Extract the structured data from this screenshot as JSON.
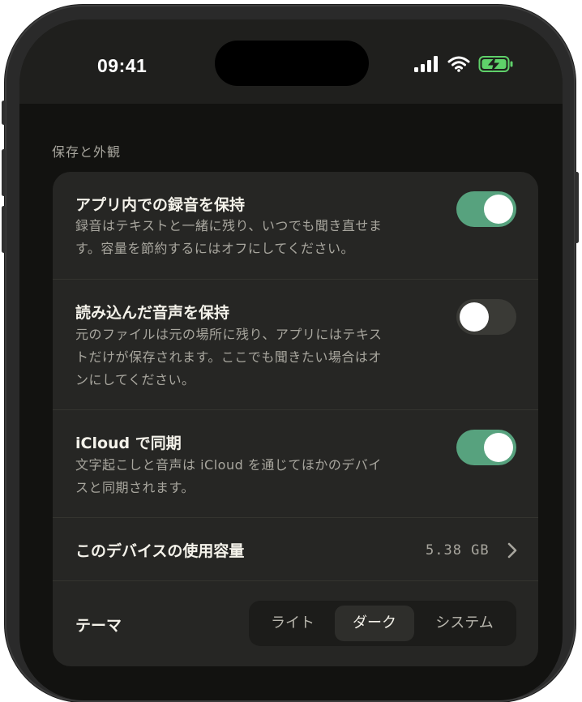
{
  "status_bar": {
    "time": "09:41"
  },
  "section_title": "保存と外観",
  "settings": {
    "keep_recordings": {
      "title": "アプリ内での録音を保持",
      "desc_line1": "録音はテキストと一緒に残り、いつでも聞き直せま",
      "desc_line2": "す。容量を節約するにはオフにしてください。",
      "enabled": true
    },
    "keep_imported": {
      "title": "読み込んだ音声を保持",
      "desc_line1": "元のファイルは元の場所に残り、アプリにはテキス",
      "desc_line2": "トだけが保存されます。ここでも聞きたい場合はオ",
      "desc_line3": "ンにしてください。",
      "enabled": false
    },
    "icloud_sync": {
      "title": "iCloud で同期",
      "desc_line1": "文字起こしと音声は iCloud を通じてほかのデバイ",
      "desc_line2": "スと同期されます。",
      "enabled": true
    },
    "storage": {
      "title": "このデバイスの使用容量",
      "value": "5.38 GB"
    },
    "theme": {
      "title": "テーマ",
      "options": [
        "ライト",
        "ダーク",
        "システム"
      ],
      "selected": "ダーク"
    }
  },
  "colors": {
    "toggle_on": "#57a27e",
    "battery_charging": "#5fd16a"
  }
}
